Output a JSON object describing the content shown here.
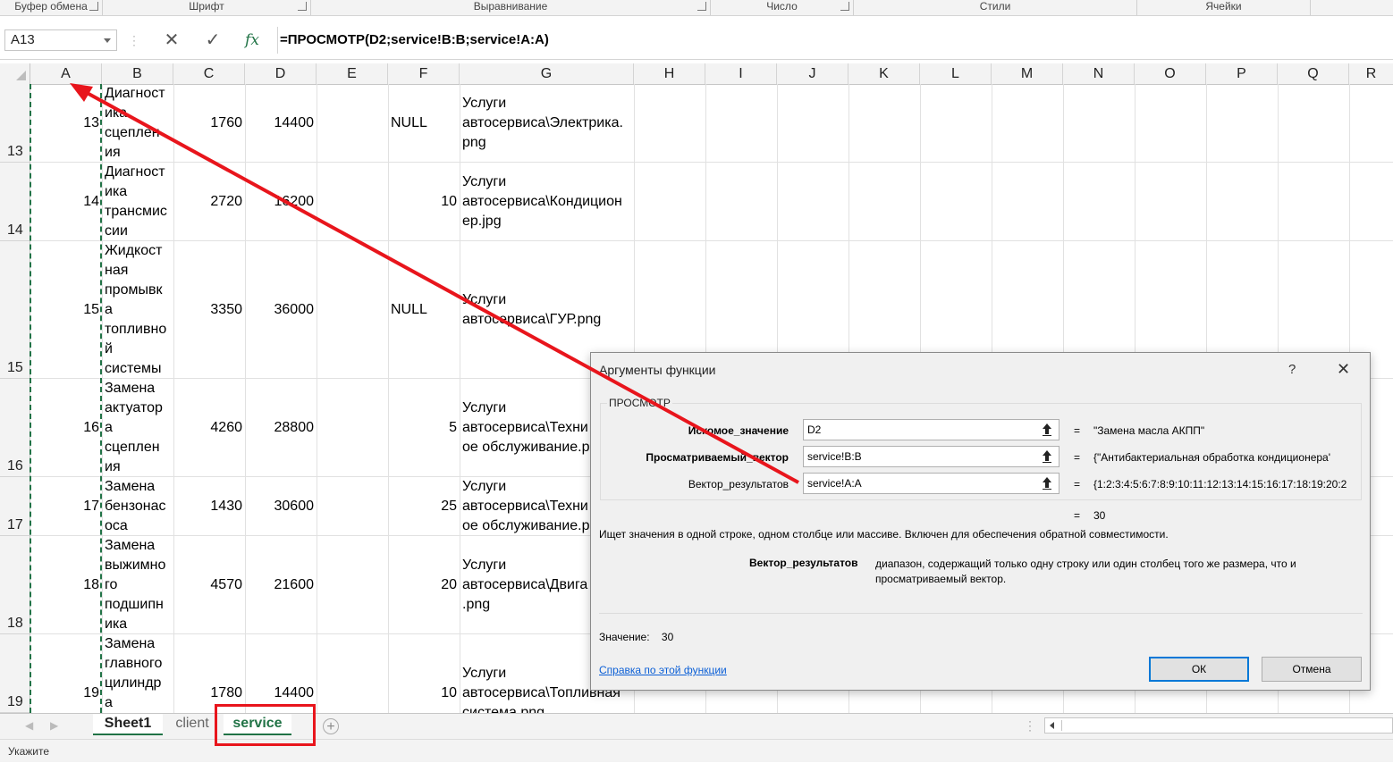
{
  "ribbon": {
    "groups": [
      "Буфер обмена",
      "Шрифт",
      "Выравнивание",
      "Число",
      "Стили",
      "Ячейки"
    ]
  },
  "formula_bar": {
    "name_box": "A13",
    "cancel_icon": "✕",
    "enter_icon": "✓",
    "fx_label": "fx",
    "formula": "=ПРОСМОТР(D2;service!B:B;service!A:A)"
  },
  "columns": [
    "A",
    "B",
    "C",
    "D",
    "E",
    "F",
    "G",
    "H",
    "I",
    "J",
    "K",
    "L",
    "M",
    "N",
    "O",
    "P",
    "Q",
    "R"
  ],
  "rows": [
    {
      "header": "13",
      "a": "13",
      "b": "Диагност\nика\nсцеплен\nия",
      "c": "1760",
      "d": "14400",
      "f": "NULL",
      "g": "Услуги\nавтосервиса\\Электрика.\npng"
    },
    {
      "header": "14",
      "a": "14",
      "b": "Диагност\nика\nтрансмис\nсии",
      "c": "2720",
      "d": "16200",
      "f": "10",
      "g": "Услуги\nавтосервиса\\Кондицион\nер.jpg"
    },
    {
      "header": "15",
      "a": "15",
      "b": "Жидкост\nная\nпромывк\nа\nтопливно\nй\nсистемы",
      "c": "3350",
      "d": "36000",
      "f": "NULL",
      "g": "Услуги\nавтосервиса\\ГУР.png"
    },
    {
      "header": "16",
      "a": "16",
      "b": "Замена\nактуатор\nа\nсцеплен\nия",
      "c": "4260",
      "d": "28800",
      "f": "5",
      "g": "Услуги\nавтосервиса\\Техни\nое обслуживание.p"
    },
    {
      "header": "17",
      "a": "17",
      "b": "Замена\nбензонас\nоса",
      "c": "1430",
      "d": "30600",
      "f": "25",
      "g": "Услуги\nавтосервиса\\Техни\nое обслуживание.p"
    },
    {
      "header": "18",
      "a": "18",
      "b": "Замена\nвыжимно\nго\nподшипн\nика",
      "c": "4570",
      "d": "21600",
      "f": "20",
      "g": "Услуги\nавтосервиса\\Двига\n.png"
    },
    {
      "header": "19",
      "a": "19",
      "b": "Замена\nглавного\nцилиндр\nа",
      "c": "1780",
      "d": "14400",
      "f": "10",
      "g": "Услуги\nавтосервиса\\Топливная\nсистема.png"
    }
  ],
  "sheet_tabs": [
    "Sheet1",
    "client",
    "service"
  ],
  "active_tab": "service",
  "status": "Укажите",
  "dialog": {
    "title": "Аргументы функции",
    "help": "?",
    "close": "✕",
    "function_name": "ПРОСМОТР",
    "args": [
      {
        "label": "Искомое_значение",
        "bold": true,
        "value": "D2",
        "result": "\"Замена масла АКПП\""
      },
      {
        "label": "Просматриваемый_вектор",
        "bold": true,
        "value": "service!B:B",
        "result": "{\"Антибактериальная обработка кондиционера'"
      },
      {
        "label": "Вектор_результатов",
        "bold": false,
        "value": "service!A:A",
        "result": "{1:2:3:4:5:6:7:8:9:10:11:12:13:14:15:16:17:18:19:20:2"
      }
    ],
    "eq": "=",
    "overall_result": "30",
    "description": "Ищет значения в одной строке, одном столбце или массиве. Включен для обеспечения обратной совместимости.",
    "arg_help_name": "Вектор_результатов",
    "arg_help_text": "диапазон, содержащий только одну строку или один столбец того же размера, что и просматриваемый вектор.",
    "value_label": "Значение:",
    "value": "30",
    "help_link": "Справка по этой функции",
    "ok": "ОК",
    "cancel": "Отмена"
  },
  "colors": {
    "accent_green": "#217346",
    "annotation_red": "#e8151c",
    "link_blue": "#0b5fd6"
  }
}
